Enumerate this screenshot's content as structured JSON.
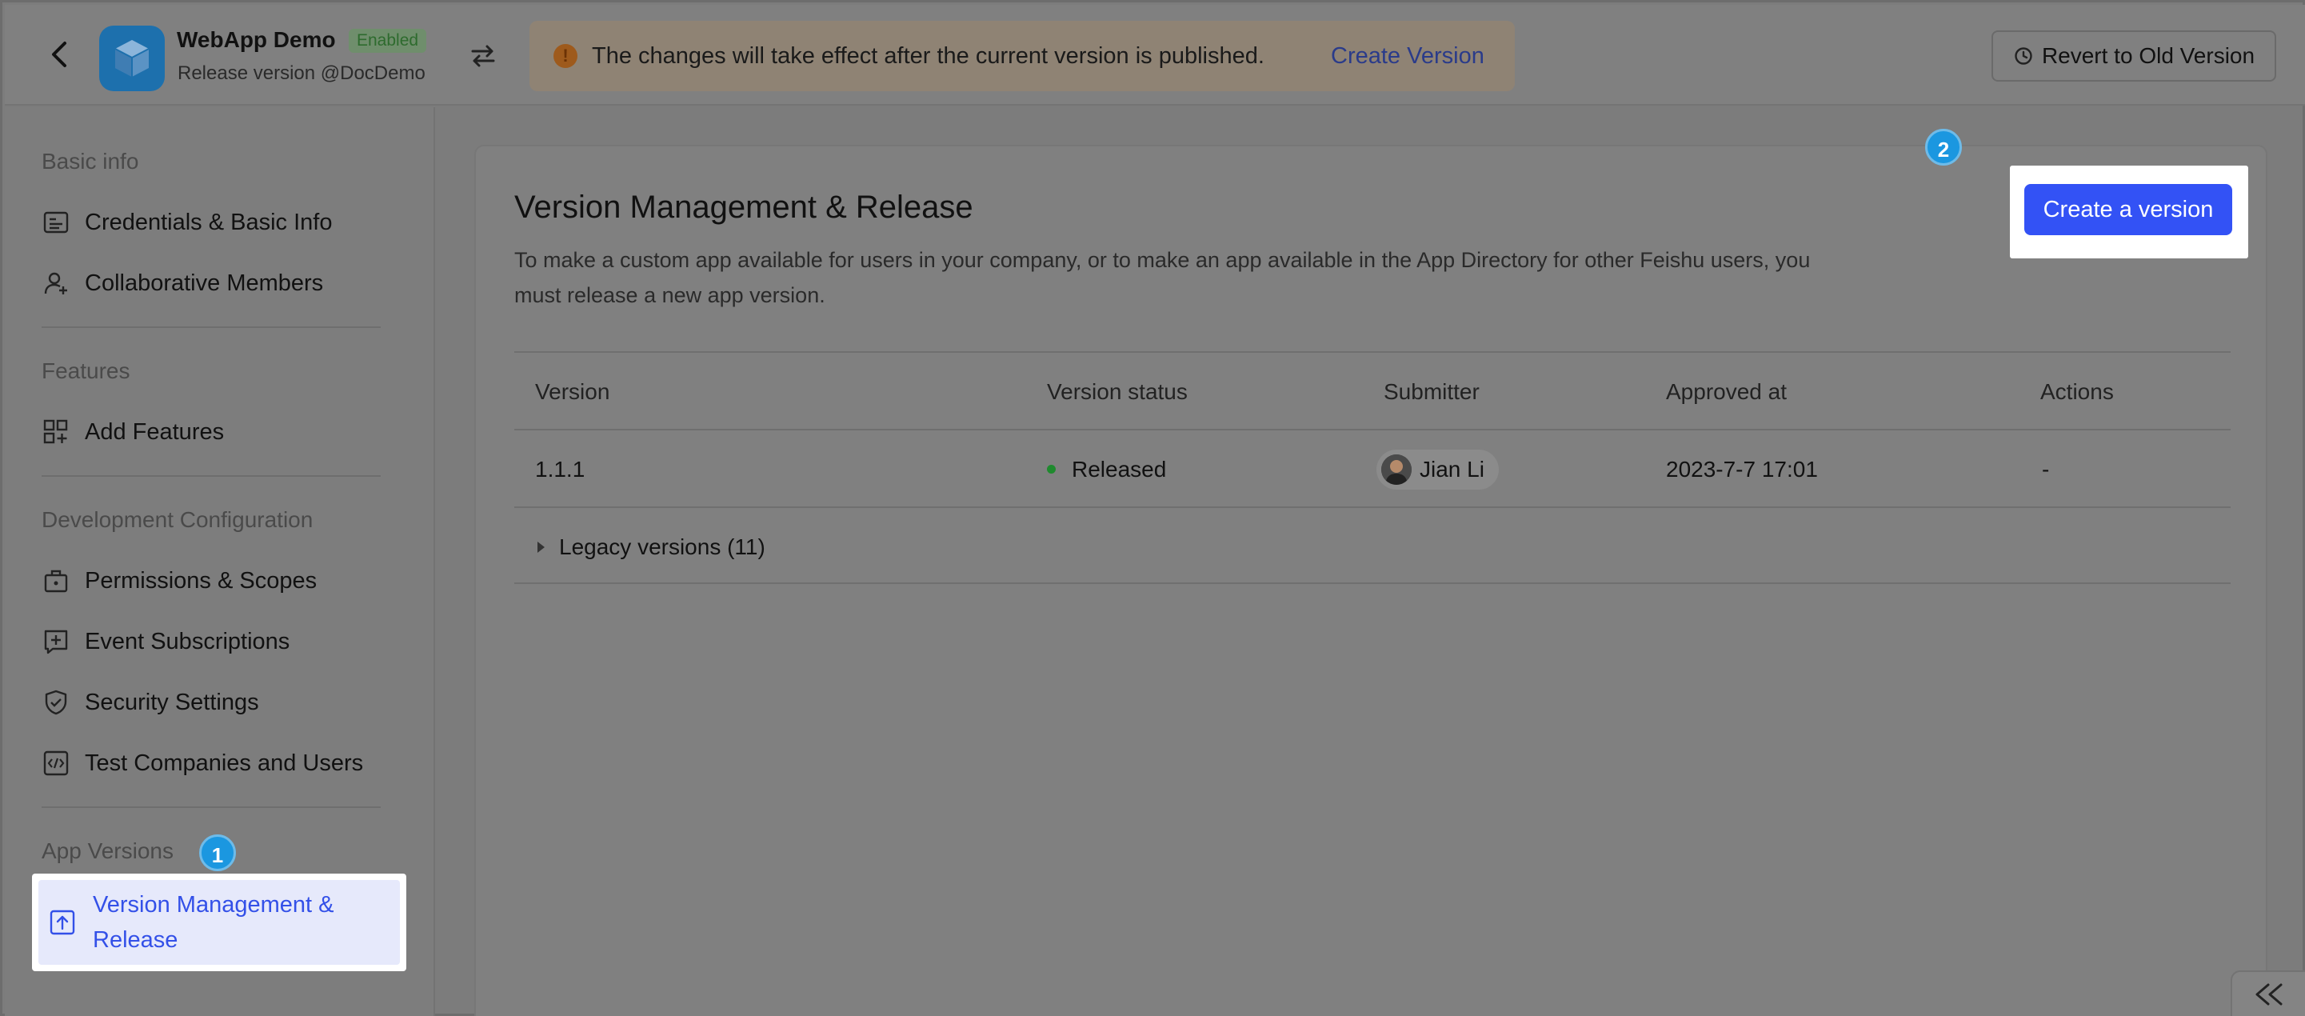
{
  "header": {
    "app_name": "WebApp Demo",
    "app_badge": "Enabled",
    "app_subtitle": "Release version @DocDemo",
    "notice_text": "The changes will take effect after the current version is published.",
    "notice_link": "Create Version",
    "notice_icon": "!",
    "revert_label": "Revert to Old Version"
  },
  "sidebar": {
    "sections": [
      {
        "title": "Basic info",
        "items": [
          {
            "label": "Credentials & Basic Info",
            "icon": "id-card-icon"
          },
          {
            "label": "Collaborative Members",
            "icon": "user-add-icon"
          }
        ]
      },
      {
        "title": "Features",
        "items": [
          {
            "label": "Add Features",
            "icon": "grid-add-icon"
          }
        ]
      },
      {
        "title": "Development Configuration",
        "items": [
          {
            "label": "Permissions & Scopes",
            "icon": "briefcase-icon"
          },
          {
            "label": "Event Subscriptions",
            "icon": "event-plus-icon"
          },
          {
            "label": "Security Settings",
            "icon": "shield-icon"
          },
          {
            "label": "Test Companies and Users",
            "icon": "code-box-icon"
          }
        ]
      },
      {
        "title": "App Versions",
        "items": [
          {
            "label": "Version Management & Release",
            "icon": "upload-box-icon",
            "active": true
          }
        ]
      }
    ]
  },
  "steps": {
    "one": "1",
    "two": "2"
  },
  "main": {
    "title": "Version Management & Release",
    "description": "To make a custom app available for users in your company, or to make an app available in the App Directory for other Feishu users, you must release a new app version.",
    "create_button": "Create a version",
    "table": {
      "headers": [
        "Version",
        "Version status",
        "Submitter",
        "Approved at",
        "Actions"
      ],
      "rows": [
        {
          "version": "1.1.1",
          "status": "Released",
          "submitter": "Jian Li",
          "approved_at": "2023-7-7 17:01",
          "actions": "-"
        }
      ],
      "legacy_label": "Legacy versions (11)"
    }
  },
  "colors": {
    "accent": "#3352f5",
    "step_badge": "#1b97e0",
    "released": "#1f8a2e"
  }
}
